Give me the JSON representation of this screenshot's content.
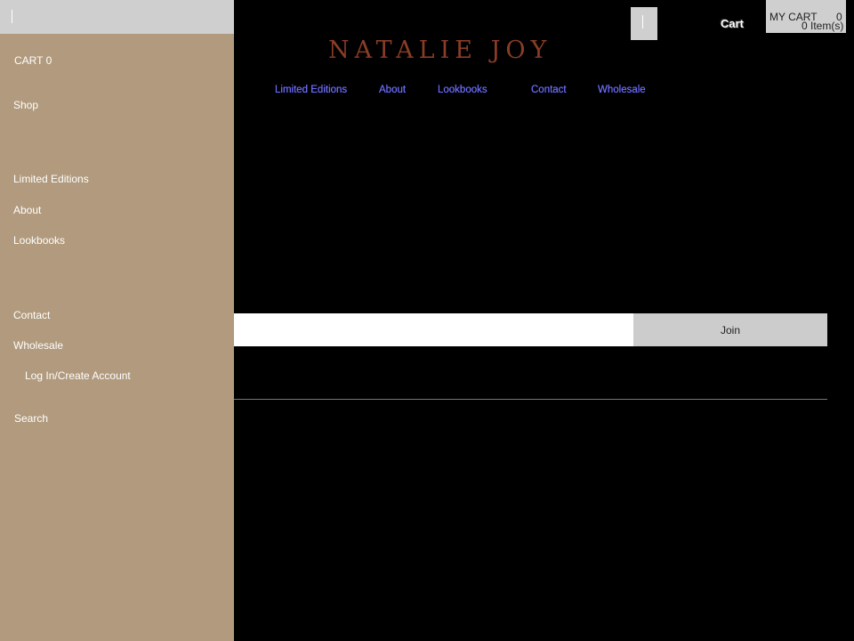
{
  "drawer": {
    "cart_label": "CART 0",
    "items": [
      "Shop",
      "Limited Editions",
      "About",
      "Lookbooks",
      "Contact",
      "Wholesale"
    ],
    "login": "Log In/Create Account",
    "search": "Search"
  },
  "header": {
    "logo": "NATALIE JOY",
    "nav": [
      "Limited Editions",
      "About",
      "Lookbooks",
      "Contact",
      "Wholesale"
    ],
    "cart_link": "Cart",
    "mini_cart": {
      "label": "MY CART",
      "count": "0",
      "items": "0 Item(s)"
    }
  },
  "newsletter": {
    "join_label": "Join",
    "placeholder": ""
  },
  "colors": {
    "drawer_bg": "#b19a7d",
    "logo": "#8a3d26",
    "nav_link": "#6d6dff",
    "page_bg": "#000000"
  }
}
